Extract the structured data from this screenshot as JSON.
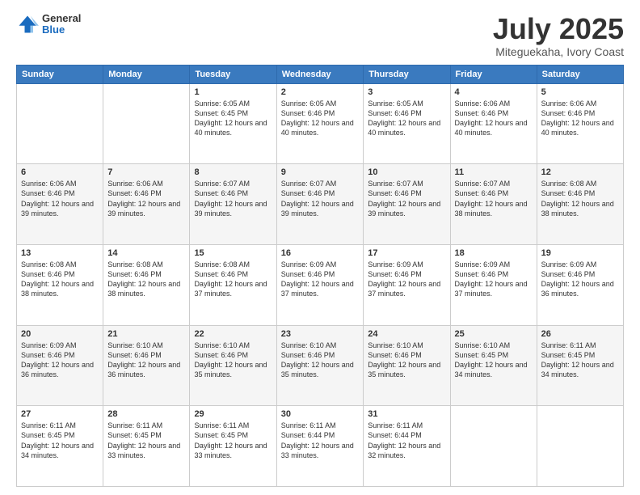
{
  "logo": {
    "general": "General",
    "blue": "Blue"
  },
  "title": {
    "month_year": "July 2025",
    "location": "Miteguekaha, Ivory Coast"
  },
  "days_of_week": [
    "Sunday",
    "Monday",
    "Tuesday",
    "Wednesday",
    "Thursday",
    "Friday",
    "Saturday"
  ],
  "weeks": [
    [
      {
        "day": "",
        "info": ""
      },
      {
        "day": "",
        "info": ""
      },
      {
        "day": "1",
        "info": "Sunrise: 6:05 AM\nSunset: 6:45 PM\nDaylight: 12 hours and 40 minutes."
      },
      {
        "day": "2",
        "info": "Sunrise: 6:05 AM\nSunset: 6:46 PM\nDaylight: 12 hours and 40 minutes."
      },
      {
        "day": "3",
        "info": "Sunrise: 6:05 AM\nSunset: 6:46 PM\nDaylight: 12 hours and 40 minutes."
      },
      {
        "day": "4",
        "info": "Sunrise: 6:06 AM\nSunset: 6:46 PM\nDaylight: 12 hours and 40 minutes."
      },
      {
        "day": "5",
        "info": "Sunrise: 6:06 AM\nSunset: 6:46 PM\nDaylight: 12 hours and 40 minutes."
      }
    ],
    [
      {
        "day": "6",
        "info": "Sunrise: 6:06 AM\nSunset: 6:46 PM\nDaylight: 12 hours and 39 minutes."
      },
      {
        "day": "7",
        "info": "Sunrise: 6:06 AM\nSunset: 6:46 PM\nDaylight: 12 hours and 39 minutes."
      },
      {
        "day": "8",
        "info": "Sunrise: 6:07 AM\nSunset: 6:46 PM\nDaylight: 12 hours and 39 minutes."
      },
      {
        "day": "9",
        "info": "Sunrise: 6:07 AM\nSunset: 6:46 PM\nDaylight: 12 hours and 39 minutes."
      },
      {
        "day": "10",
        "info": "Sunrise: 6:07 AM\nSunset: 6:46 PM\nDaylight: 12 hours and 39 minutes."
      },
      {
        "day": "11",
        "info": "Sunrise: 6:07 AM\nSunset: 6:46 PM\nDaylight: 12 hours and 38 minutes."
      },
      {
        "day": "12",
        "info": "Sunrise: 6:08 AM\nSunset: 6:46 PM\nDaylight: 12 hours and 38 minutes."
      }
    ],
    [
      {
        "day": "13",
        "info": "Sunrise: 6:08 AM\nSunset: 6:46 PM\nDaylight: 12 hours and 38 minutes."
      },
      {
        "day": "14",
        "info": "Sunrise: 6:08 AM\nSunset: 6:46 PM\nDaylight: 12 hours and 38 minutes."
      },
      {
        "day": "15",
        "info": "Sunrise: 6:08 AM\nSunset: 6:46 PM\nDaylight: 12 hours and 37 minutes."
      },
      {
        "day": "16",
        "info": "Sunrise: 6:09 AM\nSunset: 6:46 PM\nDaylight: 12 hours and 37 minutes."
      },
      {
        "day": "17",
        "info": "Sunrise: 6:09 AM\nSunset: 6:46 PM\nDaylight: 12 hours and 37 minutes."
      },
      {
        "day": "18",
        "info": "Sunrise: 6:09 AM\nSunset: 6:46 PM\nDaylight: 12 hours and 37 minutes."
      },
      {
        "day": "19",
        "info": "Sunrise: 6:09 AM\nSunset: 6:46 PM\nDaylight: 12 hours and 36 minutes."
      }
    ],
    [
      {
        "day": "20",
        "info": "Sunrise: 6:09 AM\nSunset: 6:46 PM\nDaylight: 12 hours and 36 minutes."
      },
      {
        "day": "21",
        "info": "Sunrise: 6:10 AM\nSunset: 6:46 PM\nDaylight: 12 hours and 36 minutes."
      },
      {
        "day": "22",
        "info": "Sunrise: 6:10 AM\nSunset: 6:46 PM\nDaylight: 12 hours and 35 minutes."
      },
      {
        "day": "23",
        "info": "Sunrise: 6:10 AM\nSunset: 6:46 PM\nDaylight: 12 hours and 35 minutes."
      },
      {
        "day": "24",
        "info": "Sunrise: 6:10 AM\nSunset: 6:46 PM\nDaylight: 12 hours and 35 minutes."
      },
      {
        "day": "25",
        "info": "Sunrise: 6:10 AM\nSunset: 6:45 PM\nDaylight: 12 hours and 34 minutes."
      },
      {
        "day": "26",
        "info": "Sunrise: 6:11 AM\nSunset: 6:45 PM\nDaylight: 12 hours and 34 minutes."
      }
    ],
    [
      {
        "day": "27",
        "info": "Sunrise: 6:11 AM\nSunset: 6:45 PM\nDaylight: 12 hours and 34 minutes."
      },
      {
        "day": "28",
        "info": "Sunrise: 6:11 AM\nSunset: 6:45 PM\nDaylight: 12 hours and 33 minutes."
      },
      {
        "day": "29",
        "info": "Sunrise: 6:11 AM\nSunset: 6:45 PM\nDaylight: 12 hours and 33 minutes."
      },
      {
        "day": "30",
        "info": "Sunrise: 6:11 AM\nSunset: 6:44 PM\nDaylight: 12 hours and 33 minutes."
      },
      {
        "day": "31",
        "info": "Sunrise: 6:11 AM\nSunset: 6:44 PM\nDaylight: 12 hours and 32 minutes."
      },
      {
        "day": "",
        "info": ""
      },
      {
        "day": "",
        "info": ""
      }
    ]
  ]
}
